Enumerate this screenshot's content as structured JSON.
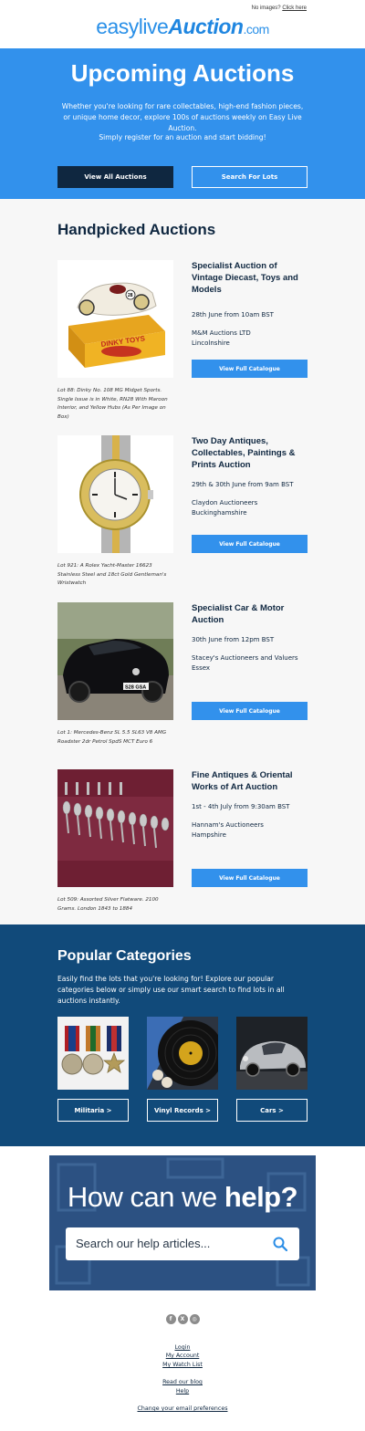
{
  "header": {
    "no_images_text": "No images?",
    "click_here": "Click here",
    "logo_part1": "easylive",
    "logo_part2": "Auction",
    "logo_part3": ".com"
  },
  "hero": {
    "title": "Upcoming Auctions",
    "intro": "Whether you're looking for rare collectables, high-end fashion pieces, or unique home decor, explore 100s of auctions weekly on Easy Live Auction.",
    "register": "Simply register for an auction and start bidding!",
    "btn_view_all": "View All Auctions",
    "btn_search": "Search For Lots"
  },
  "handpicked": {
    "heading": "Handpicked Auctions",
    "items": [
      {
        "title": "Specialist Auction of Vintage Diecast, Toys and Models",
        "date": "28th June from 10am BST",
        "house": "M&M Auctions LTD",
        "location": "Lincolnshire",
        "button": "View Full Catalogue",
        "caption": "Lot 88: Dinky No. 108 MG Midget Sports. Single Issue is in White, RN28 With Maroon Interior, and Yellow Hubs (As Per Image on Box)",
        "image": "toy-car-image"
      },
      {
        "title": "Two Day Antiques, Collectables, Paintings & Prints Auction",
        "date": "29th & 30th June from 9am BST",
        "house": "Claydon Auctioneers",
        "location": "Buckinghamshire",
        "button": "View Full Catalogue",
        "caption": "Lot 921: A Rolex Yacht-Master 16623 Stainless Steel and 18ct Gold Gentleman's Wristwatch",
        "image": "watch-image"
      },
      {
        "title": "Specialist Car & Motor Auction",
        "date": "30th June from 12pm BST",
        "house": "Stacey's Auctioneers and Valuers",
        "location": "Essex",
        "button": "View Full Catalogue",
        "caption": "Lot 1: Mercedes-Benz SL 5.5 SL63 V8 AMG Roadster 2dr Petrol SpdS MCT Euro 6",
        "image": "car-image"
      },
      {
        "title": "Fine Antiques & Oriental Works of Art Auction",
        "date": "1st - 4th July from 9:30am BST",
        "house": "Hannam's Auctioneers",
        "location": "Hampshire",
        "button": "View Full Catalogue",
        "caption": "Lot 509: Assorted Silver Flatware. 2100 Grams. London 1843 to 1884",
        "image": "silver-flatware-image"
      }
    ]
  },
  "popular": {
    "heading": "Popular Categories",
    "intro": "Easily find the lots that you're looking for! Explore our popular categories below or simply use our smart search to find lots in all auctions instantly.",
    "categories": [
      {
        "label": "Militaria >",
        "image": "medals-image"
      },
      {
        "label": "Vinyl Records >",
        "image": "vinyl-image"
      },
      {
        "label": "Cars >",
        "image": "classic-car-image"
      }
    ]
  },
  "help": {
    "heading_part1": "How can we ",
    "heading_part2": "help?",
    "search_placeholder": "Search our help articles..."
  },
  "footer": {
    "social": [
      "facebook-icon",
      "x-icon",
      "instagram-icon"
    ],
    "login": "Login",
    "my_account": "My Account",
    "my_watch_list": "My Watch List",
    "blog": "Read our blog",
    "help": "Help",
    "preferences": "Change your email preferences"
  },
  "colors": {
    "brand_blue": "#3291ec",
    "navy": "#0f2740",
    "categories_bg": "#114a7a"
  }
}
